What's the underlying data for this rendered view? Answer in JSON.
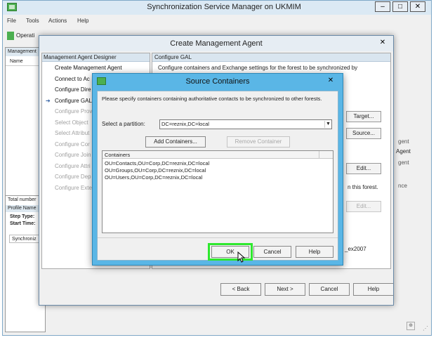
{
  "main_window": {
    "title": "Synchronization Service Manager on UKMIM",
    "controls": {
      "minimize": "–",
      "maximize": "□",
      "close": "✕"
    },
    "menu": [
      "File",
      "Tools",
      "Actions",
      "Help"
    ],
    "toolbar_first": "Operati",
    "left_panel": {
      "header": "Management",
      "column": "Name",
      "total": "Total number",
      "profile_name": "Profile Name",
      "step_type": "Step Type:",
      "start_time": "Start Time:",
      "sync_item": "Synchroniz"
    },
    "right_ghost_texts": [
      "gent",
      "Agent",
      "gent",
      "nce"
    ],
    "status_grip": "⊕",
    "resize_grip": "⋰"
  },
  "cma_dialog": {
    "title": "Create Management Agent",
    "close": "✕",
    "nav": {
      "header": "Management Agent Designer",
      "items": [
        {
          "label": "Create Management Agent",
          "state": "active",
          "arrow": false
        },
        {
          "label": "Connect to Ac",
          "state": "active",
          "arrow": false
        },
        {
          "label": "Configure Dire",
          "state": "active",
          "arrow": false
        },
        {
          "label": "Configure GAL",
          "state": "active",
          "arrow": true
        },
        {
          "label": "Configure Prov",
          "state": "disabled",
          "arrow": false
        },
        {
          "label": "Select Object",
          "state": "disabled",
          "arrow": false
        },
        {
          "label": "Select Attribut",
          "state": "disabled",
          "arrow": false
        },
        {
          "label": "Configure Cor",
          "state": "disabled",
          "arrow": false
        },
        {
          "label": "Configure Join",
          "state": "disabled",
          "arrow": false
        },
        {
          "label": "Configure Attri",
          "state": "disabled",
          "arrow": false
        },
        {
          "label": "Configure Dep",
          "state": "disabled",
          "arrow": false
        },
        {
          "label": "Configure Exte",
          "state": "disabled",
          "arrow": false
        }
      ]
    },
    "content": {
      "header": "Configure GAL",
      "description": "Configure containers and Exchange settings for the forest to be synchronized by",
      "target_btn": "Target...",
      "source_btn": "Source...",
      "edit_btn": "Edit...",
      "forest_text": "n this forest.",
      "edit_btn2": "Edit...",
      "ex_text": "_ex2007"
    },
    "footer": {
      "back": "< Back",
      "next": "Next >",
      "cancel": "Cancel",
      "help": "Help"
    }
  },
  "source_containers": {
    "title": "Source Containers",
    "close": "✕",
    "instructions": "Please specify containers containing authoritative contacts to be synchronized to other forests.",
    "partition_label": "Select a partition:",
    "partition_value": "DC=reznix,DC=local",
    "add_btn": "Add Containers...",
    "remove_btn": "Remove Container",
    "list_header": "Containers",
    "containers": [
      "OU=Contacts,OU=Corp,DC=reznix,DC=local",
      "OU=Groups,OU=Corp,DC=reznix,DC=local",
      "OU=Users,OU=Corp,DC=reznix,DC=local"
    ],
    "ok": "OK",
    "cancel": "Cancel",
    "help": "Help",
    "highlight_color": "#2ee82e"
  }
}
